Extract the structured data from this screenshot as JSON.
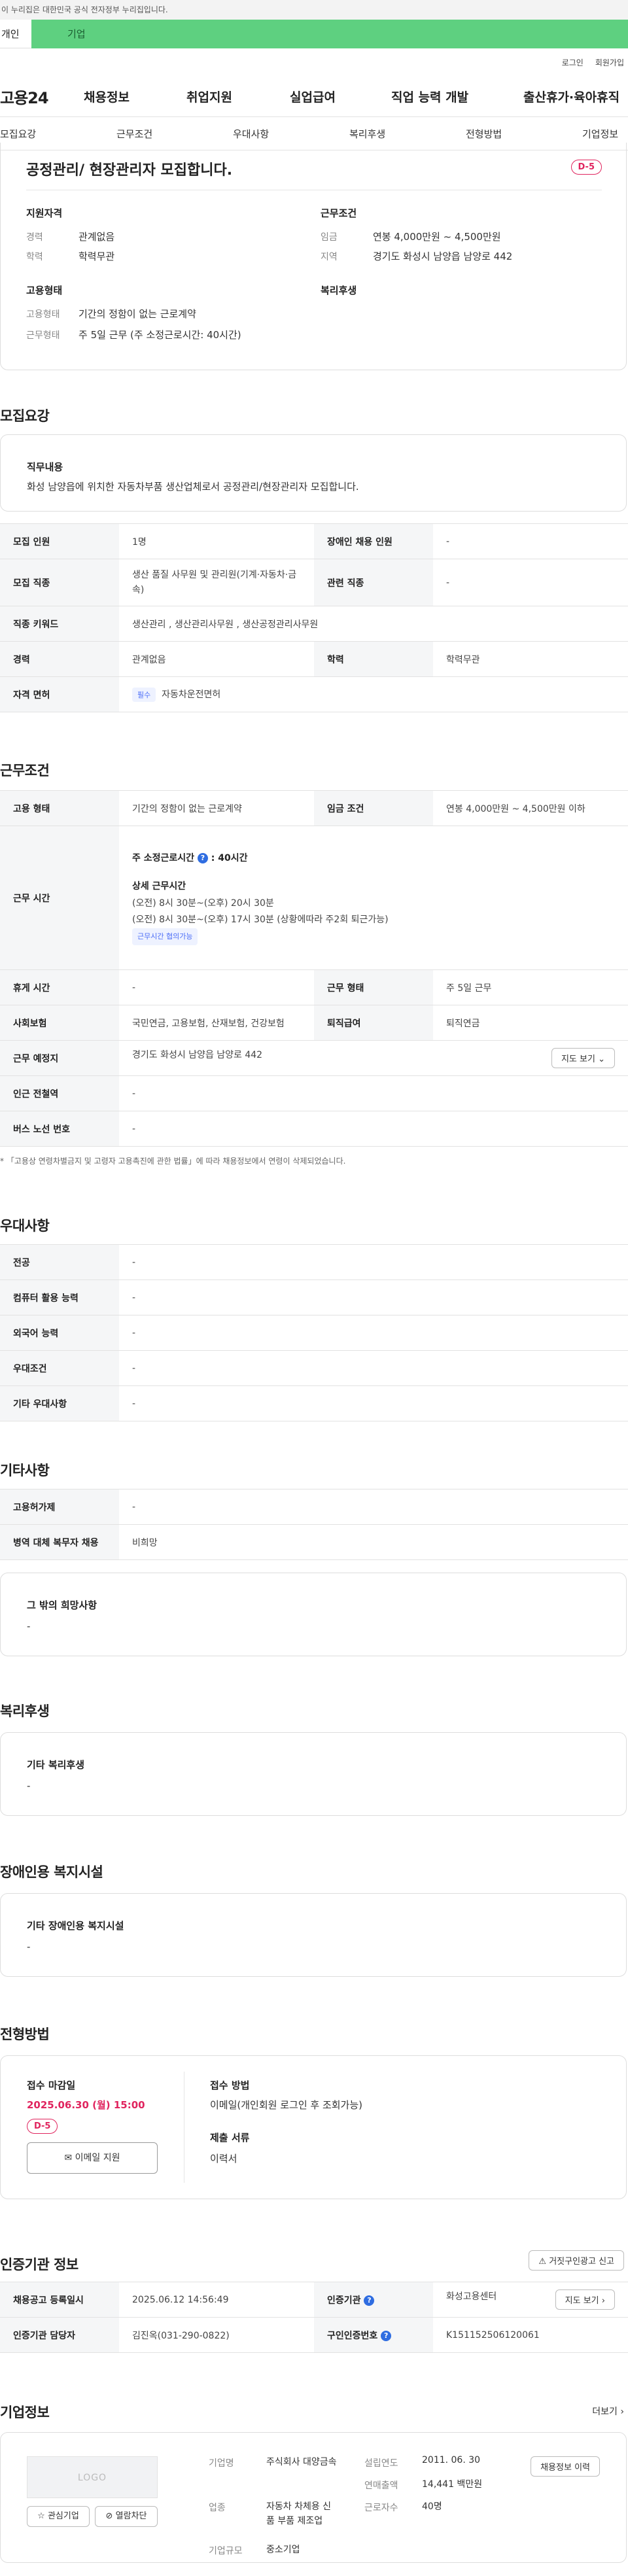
{
  "gov_banner": "이 누리집은 대한민국 공식 전자정부 누리집입니다.",
  "top_tabs": [
    "개인",
    "기업"
  ],
  "util": [
    "로그인",
    "회원가입"
  ],
  "logo": "고용24",
  "gnb": [
    "채용정보",
    "취업지원",
    "실업급여",
    "직업 능력 개발",
    "출산휴가·육아휴직"
  ],
  "anchors": [
    "모집요강",
    "근무조건",
    "우대사항",
    "복리후생",
    "전형방법",
    "기업정보"
  ],
  "summary": {
    "title": "공정관리/ 현장관리자 모집합니다.",
    "dday": "D-5",
    "qual_title": "지원자격",
    "qual": [
      {
        "k": "경력",
        "v": "관계없음"
      },
      {
        "k": "학력",
        "v": "학력무관"
      }
    ],
    "cond_title": "근무조건",
    "cond": [
      {
        "k": "임금",
        "v": "연봉 4,000만원 ~ 4,500만원"
      },
      {
        "k": "지역",
        "v": "경기도 화성시 남양읍 남양로 442"
      }
    ],
    "emp_title": "고용형태",
    "emp": [
      {
        "k": "고용형태",
        "v": "기간의 정함이 없는 근로계약"
      },
      {
        "k": "근무형태",
        "v": "주 5일 근무 (주 소정근로시간: 40시간)"
      }
    ],
    "welfare_title": "복리후생"
  },
  "recruit": {
    "heading": "모집요강",
    "duty_title": "직무내용",
    "duty_text": "화성 남양읍에 위치한 자동차부품 생산업체로서 공정관리/현장관리자 모집합니다.",
    "rows": [
      {
        "k1": "모집 인원",
        "v1": "1명",
        "k2": "장애인 채용 인원",
        "v2": "-"
      },
      {
        "k1": "모집 직종",
        "v1": "생산 품질 사무원 및 관리원(기계·자동차·금속)",
        "k2": "관련 직종",
        "v2": "-"
      },
      {
        "k1": "직종 키워드",
        "v1": "생산관리 , 생산관리사무원 , 생산공정관리사무원"
      },
      {
        "k1": "경력",
        "v1": "관계없음",
        "k2": "학력",
        "v2": "학력무관"
      },
      {
        "k1": "자격 면허",
        "tag": "필수",
        "v1": "자동차운전면허"
      }
    ]
  },
  "work": {
    "heading": "근무조건",
    "type_k": "고용 형태",
    "type_v": "기간의 정함이 없는 근로계약",
    "wage_k": "임금 조건",
    "wage_v": "연봉 4,000만원 ~ 4,500만원 이하",
    "time_k": "근무 시간",
    "time_main": "주 소정근로시간",
    "time_main_v": ": 40시간",
    "time_detail_title": "상세 근무시간",
    "time_lines": [
      "(오전) 8시 30분~(오후) 20시 30분",
      "(오전) 8시 30분~(오후) 17시 30분 (상황에따라 주2회 퇴근가능)"
    ],
    "time_tag": "근무시간 협의가능",
    "rest_k": "휴게 시간",
    "rest_v": "-",
    "form_k": "근무 형태",
    "form_v": "주 5일 근무",
    "ins_k": "사회보험",
    "ins_v": "국민연금, 고용보험, 산재보험, 건강보험",
    "sev_k": "퇴직급여",
    "sev_v": "퇴직연금",
    "place_k": "근무 예정지",
    "place_v": "경기도 화성시 남양읍 남양로 442",
    "map_btn": "지도 보기",
    "subway_k": "인근 전철역",
    "subway_v": "-",
    "bus_k": "버스 노선 번호",
    "bus_v": "-",
    "note": "* 「고용상 연령차별금지 및 고령자 고용촉진에 관한 법률」에 따라 채용정보에서 연령이 삭제되었습니다."
  },
  "pref": {
    "heading": "우대사항",
    "rows": [
      {
        "k": "전공",
        "v": "-"
      },
      {
        "k": "컴퓨터 활용 능력",
        "v": "-"
      },
      {
        "k": "외국어 능력",
        "v": "-"
      },
      {
        "k": "우대조건",
        "v": "-"
      },
      {
        "k": "기타 우대사항",
        "v": "-"
      }
    ]
  },
  "etc": {
    "heading": "기타사항",
    "rows": [
      {
        "k": "고용허가제",
        "v": "-"
      },
      {
        "k": "병역 대체 복무자 채용",
        "v": "비희망"
      }
    ],
    "other_title": "그 밖의 희망사항",
    "other_v": "-"
  },
  "welfare": {
    "heading": "복리후생",
    "title": "기타 복리후생",
    "v": "-"
  },
  "disability": {
    "heading": "장애인용 복지시설",
    "title": "기타 장애인용 복지시설",
    "v": "-"
  },
  "process": {
    "heading": "전형방법",
    "deadline_title": "접수 마감일",
    "deadline": "2025.06.30 (월) 15:00",
    "dday": "D-5",
    "apply_btn": "이메일 지원",
    "method_title": "접수 방법",
    "method_v": "이메일(개인회원 로그인 후 조회가능)",
    "docs_title": "제출 서류",
    "docs_v": "이력서"
  },
  "agency": {
    "heading": "인증기관 정보",
    "report_btn": "거짓구인광고 신고",
    "rows": [
      {
        "k1": "채용공고 등록일시",
        "v1": "2025.06.12 14:56:49",
        "k2": "인증기관",
        "v2": "화성고용센터",
        "btn": "지도 보기"
      },
      {
        "k1": "인증기관 담당자",
        "v1": "김진옥(031-290-0822)",
        "k2": "구인인증번호",
        "v2": "K151152506120061"
      }
    ]
  },
  "company": {
    "heading": "기업정보",
    "more": "더보기",
    "logo_text": "LOGO",
    "fav_btn": "관심기업",
    "block_btn": "열람차단",
    "name_k": "기업명",
    "name_v": "주식회사 대양금속",
    "ind_k": "업종",
    "ind_v": "자동차 차체용 신품 부품 제조업",
    "size_k": "기업규모",
    "size_v": "중소기업",
    "est_k": "설립연도",
    "est_v": "2011. 06. 30",
    "sales_k": "연매출액",
    "sales_v": "14,441 백만원",
    "emp_k": "근로자수",
    "emp_v": "40명",
    "history_btn": "채용정보 이력"
  }
}
